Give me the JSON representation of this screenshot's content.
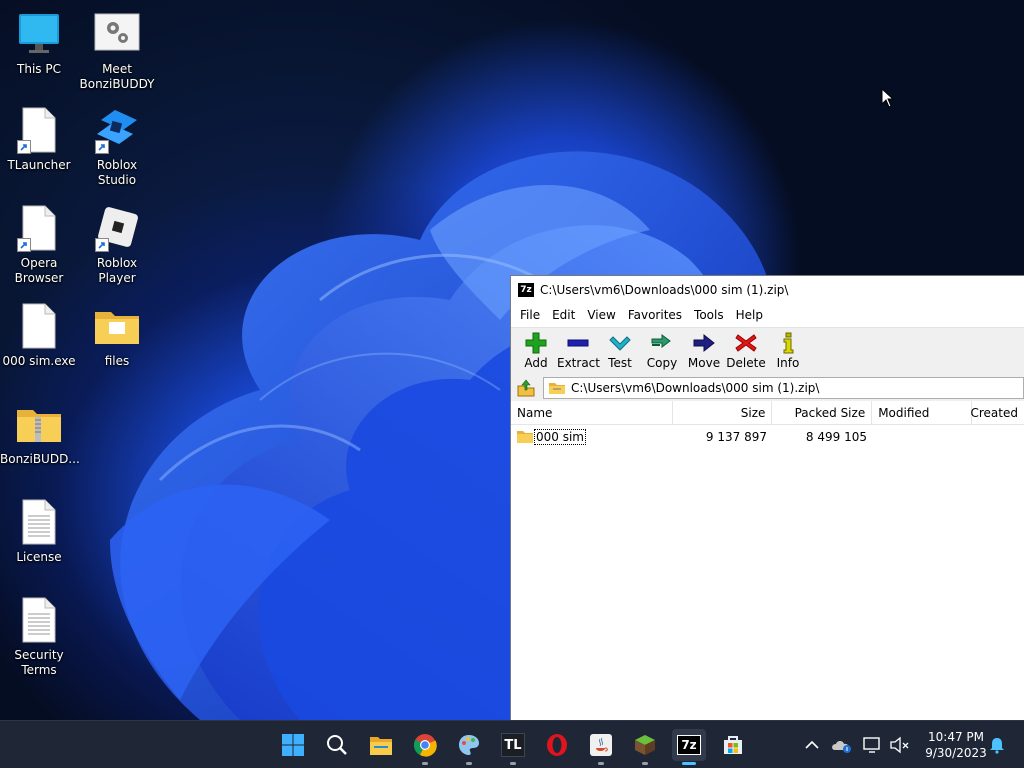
{
  "desktop": {
    "icons": [
      {
        "label": "This PC",
        "icon": "monitor-icon"
      },
      {
        "label": "Meet BonziBUDDY",
        "icon": "settings-app-icon"
      },
      {
        "label": "TLauncher",
        "icon": "file-shortcut-icon"
      },
      {
        "label": "Roblox Studio",
        "icon": "roblox-studio-icon"
      },
      {
        "label": "Opera Browser",
        "icon": "file-shortcut-icon"
      },
      {
        "label": "Roblox Player",
        "icon": "roblox-player-icon"
      },
      {
        "label": "000 sim.exe",
        "icon": "file-icon"
      },
      {
        "label": "files",
        "icon": "folder-icon"
      },
      {
        "label": "BonziBUDD...",
        "icon": "zip-folder-icon"
      },
      {
        "label": "License",
        "icon": "text-document-icon"
      },
      {
        "label": "Security Terms",
        "icon": "text-document-icon"
      }
    ]
  },
  "window": {
    "title": "C:\\Users\\vm6\\Downloads\\000 sim (1).zip\\",
    "menu": [
      "File",
      "Edit",
      "View",
      "Favorites",
      "Tools",
      "Help"
    ],
    "toolbar": [
      {
        "label": "Add",
        "icon": "plus-icon",
        "color": "#1fa31f"
      },
      {
        "label": "Extract",
        "icon": "minus-icon",
        "color": "#1f1fb0"
      },
      {
        "label": "Test",
        "icon": "check-icon",
        "color": "#22b0c8"
      },
      {
        "label": "Copy",
        "icon": "double-arrow-icon",
        "color": "#2a9a6a"
      },
      {
        "label": "Move",
        "icon": "arrow-right-icon",
        "color": "#1f1f80"
      },
      {
        "label": "Delete",
        "icon": "x-icon",
        "color": "#e01818"
      },
      {
        "label": "Info",
        "icon": "info-icon",
        "color": "#b8b800"
      }
    ],
    "address": "C:\\Users\\vm6\\Downloads\\000 sim (1).zip\\",
    "columns": [
      "Name",
      "Size",
      "Packed Size",
      "Modified",
      "Created"
    ],
    "rows": [
      {
        "name": "000 sim",
        "size": "9 137 897",
        "packed": "8 499 105",
        "modified": "",
        "created": ""
      }
    ]
  },
  "taskbar": {
    "apps": [
      "start-icon",
      "search-icon",
      "file-explorer-icon",
      "chrome-icon",
      "paint-icon",
      "tlauncher-icon",
      "opera-icon",
      "java-icon",
      "minecraft-icon",
      "7zip-icon",
      "store-icon"
    ],
    "tlauncher_text": "TL",
    "sevenzip_text": "7z",
    "time": "10:47 PM",
    "date": "9/30/2023"
  }
}
